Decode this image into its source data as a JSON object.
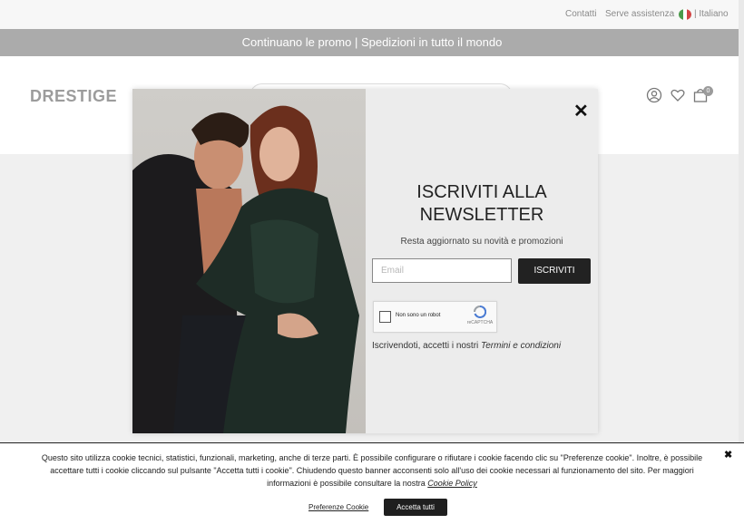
{
  "topbar": {
    "contact": "Contatti",
    "help": "Serve assistenza",
    "language": "| Italiano",
    "flag_colors": [
      "#4a9a4a",
      "#ffffff",
      "#d24545"
    ]
  },
  "promo": {
    "text": "Continuano le promo | Spedizioni in tutto il mondo"
  },
  "header": {
    "logo": "DRESTIGE",
    "cart_count": "0",
    "icons": [
      "account-icon",
      "heart-icon",
      "bag-icon"
    ]
  },
  "modal": {
    "title": "ISCRIVITI ALLA NEWSLETTER",
    "subtitle": "Resta aggiornato su novità e promozioni",
    "email_placeholder": "Email",
    "subscribe_label": "ISCRIVITI",
    "captcha_label": "Non sono un robot",
    "captcha_brand": "reCAPTCHA",
    "terms_prefix": "Iscrivendoti, accetti i nostri",
    "terms_link": "Termini e condizioni",
    "close": "✕"
  },
  "cookie": {
    "text": "Questo sito utilizza cookie tecnici, statistici, funzionali, marketing, anche di terze parti. È possibile configurare o rifiutare i cookie facendo clic su \"Preferenze cookie\". Inoltre, è possibile accettare tutti i cookie cliccando sul pulsante \"Accetta tutti i cookie\". Chiudendo questo banner acconsenti solo all'uso dei cookie necessari al funzionamento del sito. Per maggiori informazioni è possibile consultare la nostra",
    "policy_link": "Cookie Policy",
    "preferences": "Preferenze Cookie",
    "accept": "Accetta tutti",
    "close": "✖"
  }
}
